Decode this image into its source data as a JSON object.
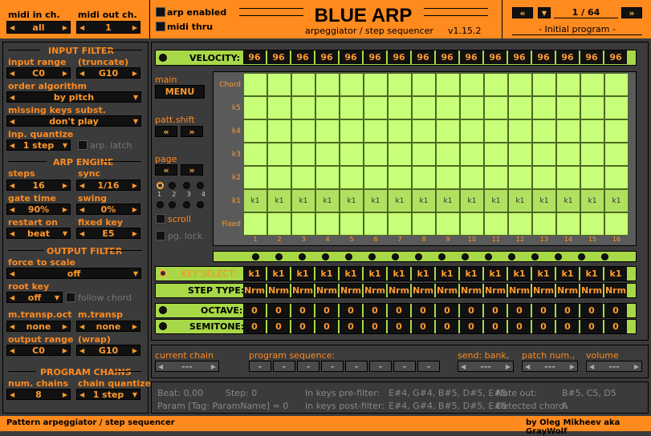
{
  "title": "BLUE ARP",
  "subtitle": "arpeggiator / step sequencer",
  "version": "v1.15.2",
  "midi_in": {
    "label": "midi in ch.",
    "value": "all"
  },
  "midi_out": {
    "label": "midi out ch.",
    "value": "1"
  },
  "arp_enabled": "arp enabled",
  "midi_thru": "midi thru",
  "program": {
    "page": "1 / 64",
    "name": "- Initial program -"
  },
  "input_filter": {
    "title": "INPUT FILTER",
    "range_label": "input range",
    "truncate_label": "(truncate)",
    "range_low": "C0",
    "range_high": "G10",
    "order_label": "order algorithm",
    "order_value": "by pitch",
    "missing_label": "missing keys subst.",
    "missing_value": "don't play",
    "quantize_label": "inp. quantize",
    "quantize_value": "1 step",
    "latch_label": "arp. latch"
  },
  "arp_engine": {
    "title": "ARP ENGINE",
    "steps_label": "steps",
    "steps_value": "16",
    "sync_label": "sync",
    "sync_value": "1/16",
    "gate_label": "gate time",
    "gate_value": "90%",
    "swing_label": "swing",
    "swing_value": "0%",
    "restart_label": "restart on",
    "restart_value": "beat",
    "fixed_label": "fixed key",
    "fixed_value": "E5"
  },
  "output_filter": {
    "title": "OUTPUT FILTER",
    "force_label": "force to scale",
    "force_value": "off",
    "root_label": "root key",
    "root_value": "off",
    "follow_label": "follow chord",
    "mtranspoct_label": "m.transp.oct",
    "mtranspoct_value": "none",
    "mtransp_label": "m.transp",
    "mtransp_value": "none",
    "outrange_label": "output range",
    "wrap_label": "(wrap)",
    "out_low": "C0",
    "out_high": "G10"
  },
  "program_chains": {
    "title": "PROGRAM CHAINS",
    "num_label": "num. chains",
    "num_value": "8",
    "cq_label": "chain quantize",
    "cq_value": "1 step"
  },
  "velocity_label": "VELOCITY:",
  "velocity": [
    "96",
    "96",
    "96",
    "96",
    "96",
    "96",
    "96",
    "96",
    "96",
    "96",
    "96",
    "96",
    "96",
    "96",
    "96",
    "96"
  ],
  "main_label": "main",
  "menu_label": "MENU",
  "pattshift_label": "patt.shift",
  "page_label": "page",
  "page_nums": [
    "1",
    "2",
    "3",
    "4"
  ],
  "scroll_label": "scroll",
  "pglock_label": "pg. lock",
  "row_labels": [
    "Chord",
    "k5",
    "k4",
    "k3",
    "k2",
    "k1",
    "Fixed"
  ],
  "k1_cells": [
    "k1",
    "k1",
    "k1",
    "k1",
    "k1",
    "k1",
    "k1",
    "k1",
    "k1",
    "k1",
    "k1",
    "k1",
    "k1",
    "k1",
    "k1",
    "k1"
  ],
  "step_nums": [
    "1",
    "2",
    "3",
    "4",
    "5",
    "6",
    "7",
    "8",
    "9",
    "10",
    "11",
    "12",
    "13",
    "14",
    "15",
    "16"
  ],
  "key_select_label": "KEY SELECT:",
  "key_select": [
    "k1",
    "k1",
    "k1",
    "k1",
    "k1",
    "k1",
    "k1",
    "k1",
    "k1",
    "k1",
    "k1",
    "k1",
    "k1",
    "k1",
    "k1",
    "k1"
  ],
  "step_type_label": "STEP TYPE:",
  "step_type": [
    "Nrm",
    "Nrm",
    "Nrm",
    "Nrm",
    "Nrm",
    "Nrm",
    "Nrm",
    "Nrm",
    "Nrm",
    "Nrm",
    "Nrm",
    "Nrm",
    "Nrm",
    "Nrm",
    "Nrm",
    "Nrm"
  ],
  "octave_label": "OCTAVE:",
  "octave": [
    "0",
    "0",
    "0",
    "0",
    "0",
    "0",
    "0",
    "0",
    "0",
    "0",
    "0",
    "0",
    "0",
    "0",
    "0",
    "0"
  ],
  "semitone_label": "SEMITONE:",
  "semitone": [
    "0",
    "0",
    "0",
    "0",
    "0",
    "0",
    "0",
    "0",
    "0",
    "0",
    "0",
    "0",
    "0",
    "0",
    "0",
    "0"
  ],
  "chain": {
    "current_label": "current chain",
    "current_value": "---",
    "seq_label": "program sequence:",
    "seq": [
      "-",
      "-",
      "-",
      "-",
      "-",
      "-",
      "-",
      "-"
    ],
    "bank_label": "send: bank,",
    "bank_value": "---",
    "pnum_label": "patch num.,",
    "pnum_value": "---",
    "vol_label": "volume",
    "vol_value": "---"
  },
  "status": {
    "beat": "Beat: 0,00",
    "step": "Step: 0",
    "param": "Param [Tag: ParamName] = 0",
    "prefilter_label": "In keys pre-filter:",
    "prefilter": "E#4, G#4, B#5, D#5, E#5",
    "postfilter_label": "In keys post-filter:",
    "postfilter": "E#4, G#4, B#5, D#5, E#5",
    "noteout_label": "Note out:",
    "noteout": "B#5, C5, D5",
    "chord_label": "Detected chord:",
    "chord": "A"
  },
  "footer_left": "Pattern arpeggiator / step sequencer",
  "footer_right": "by Oleg Mikheev aka GrayWolf"
}
